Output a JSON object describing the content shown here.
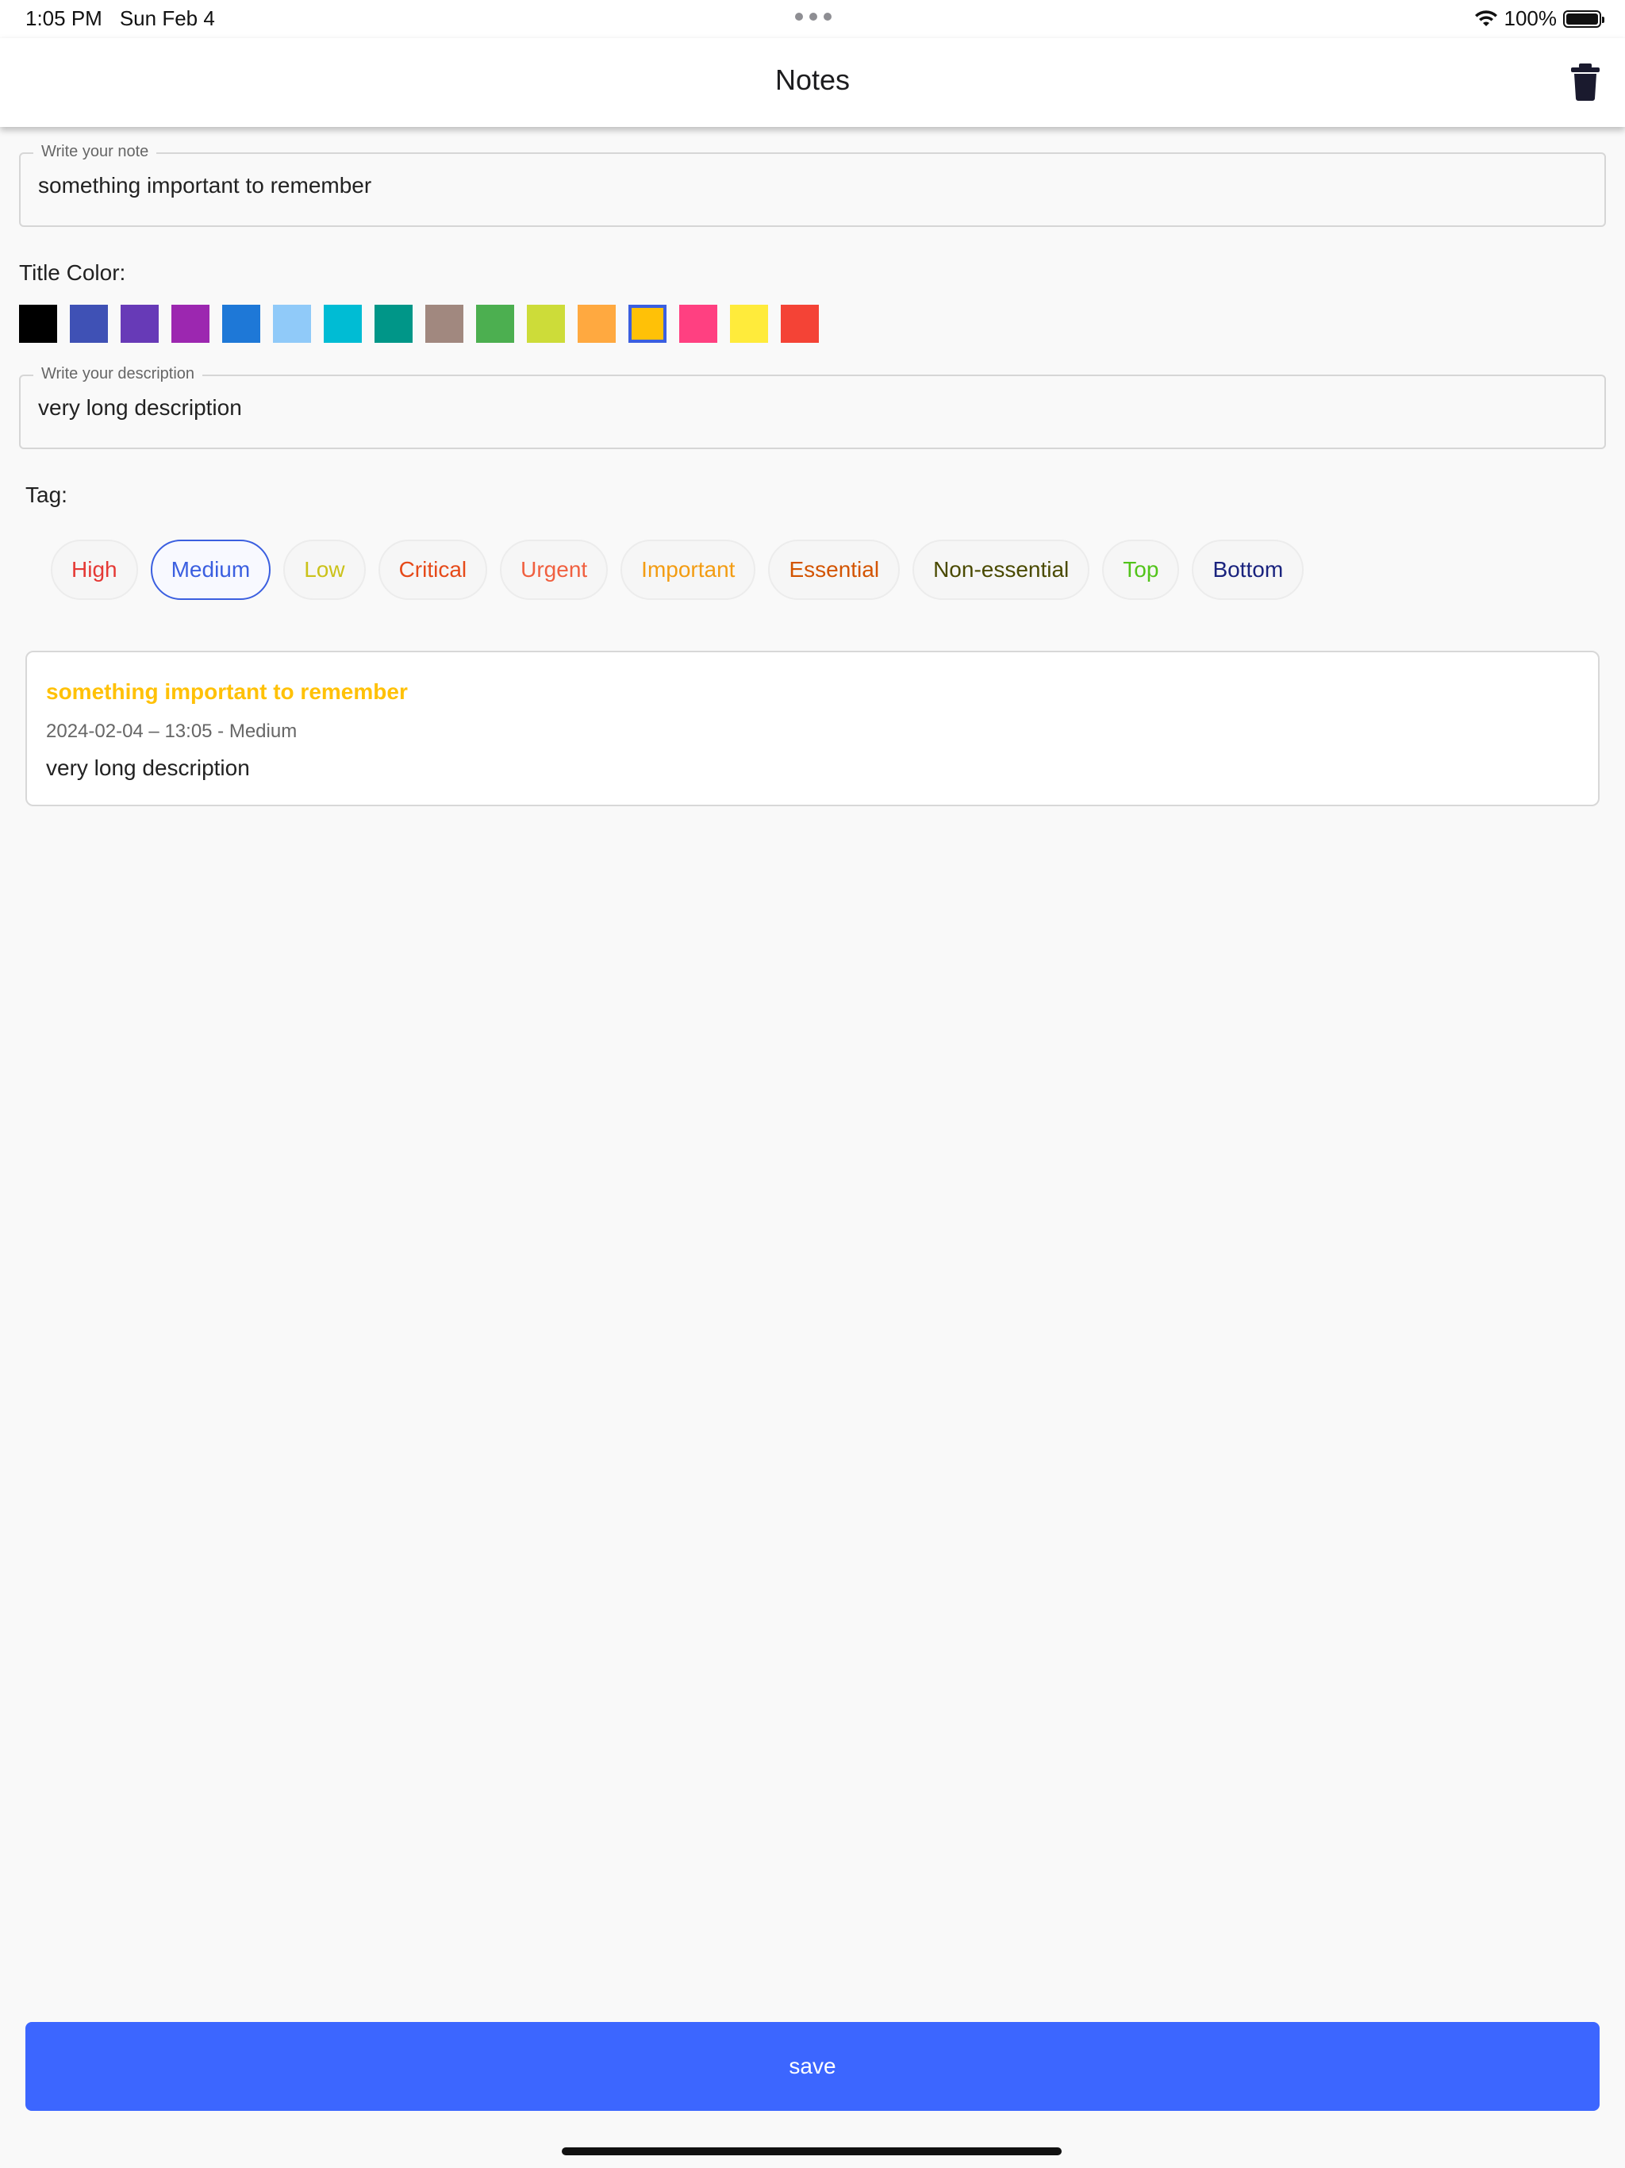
{
  "status_bar": {
    "time": "1:05 PM",
    "date": "Sun Feb 4",
    "battery": "100%",
    "battery_level": 1.0
  },
  "app_bar": {
    "title": "Notes",
    "delete_icon": "trash-icon"
  },
  "note_field": {
    "label": "Write your note",
    "value": "something important to remember"
  },
  "title_color": {
    "label": "Title Color:",
    "selected_index": 12,
    "swatches": [
      {
        "color": "#000000"
      },
      {
        "color": "#3f51b5"
      },
      {
        "color": "#673ab7"
      },
      {
        "color": "#9c27b0"
      },
      {
        "color": "#1e78d7"
      },
      {
        "color": "#90caf9"
      },
      {
        "color": "#00bcd4"
      },
      {
        "color": "#009688"
      },
      {
        "color": "#a1887f"
      },
      {
        "color": "#4caf50"
      },
      {
        "color": "#cddc39"
      },
      {
        "color": "#ffa940"
      },
      {
        "color": "#ffc107"
      },
      {
        "color": "#ff4081"
      },
      {
        "color": "#ffeb3b"
      },
      {
        "color": "#f44336"
      }
    ]
  },
  "description_field": {
    "label": "Write your description",
    "value": "very long description"
  },
  "tag": {
    "label": "Tag:",
    "selected_index": 1,
    "options": [
      {
        "label": "High",
        "color": "#e53935"
      },
      {
        "label": "Medium",
        "color": "#3b5fe0"
      },
      {
        "label": "Low",
        "color": "#cbc21a"
      },
      {
        "label": "Critical",
        "color": "#e64a19"
      },
      {
        "label": "Urgent",
        "color": "#f06040"
      },
      {
        "label": "Important",
        "color": "#f39c12"
      },
      {
        "label": "Essential",
        "color": "#d35400"
      },
      {
        "label": "Non-essential",
        "color": "#4a4a00"
      },
      {
        "label": "Top",
        "color": "#52c41a"
      },
      {
        "label": "Bottom",
        "color": "#1a237e"
      }
    ]
  },
  "note_card": {
    "title": "something important to remember",
    "title_color": "#ffc107",
    "meta": "2024-02-04 – 13:05 - Medium",
    "description": "very long description"
  },
  "save_button": {
    "label": "save",
    "color": "#3c66ff"
  }
}
